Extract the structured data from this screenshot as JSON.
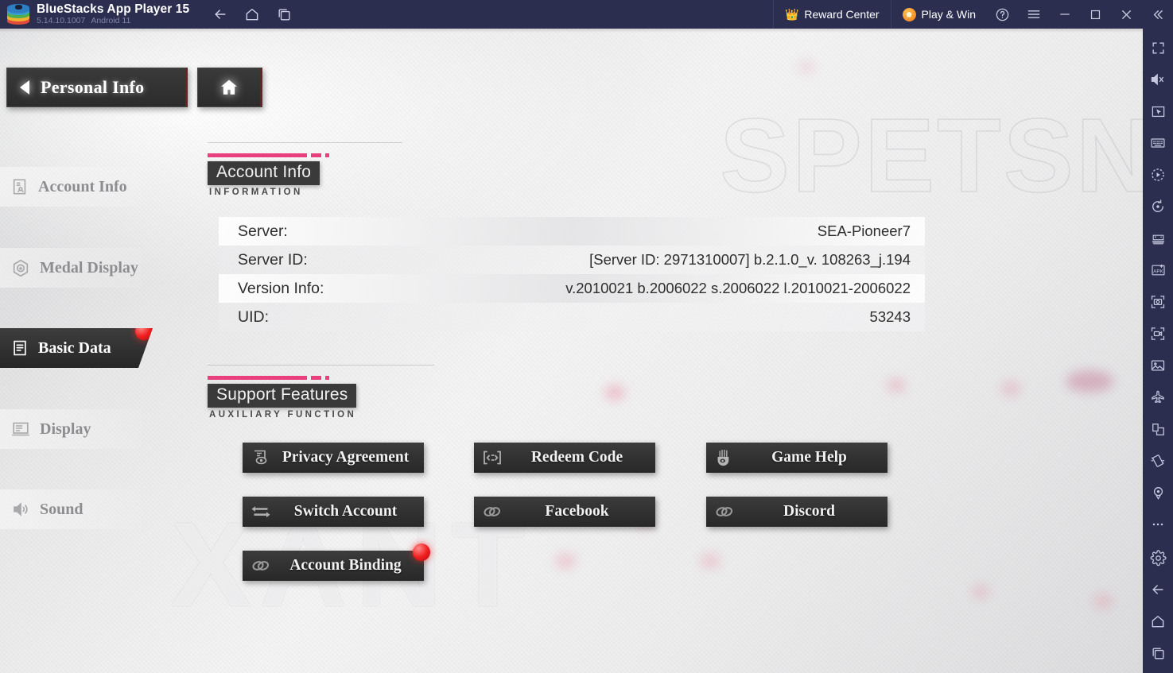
{
  "bluestacks": {
    "title": "BlueStacks App Player 15",
    "version": "5.14.10.1007",
    "android": "Android 11",
    "nav": [
      {
        "name": "back-icon",
        "label": "Back"
      },
      {
        "name": "home-icon",
        "label": "Home"
      },
      {
        "name": "recents-icon",
        "label": "Recent apps"
      }
    ],
    "reward_center": "Reward Center",
    "play_and_win": "Play & Win",
    "window_buttons": [
      {
        "name": "help-icon",
        "label": "Help"
      },
      {
        "name": "menu-icon",
        "label": "Menu"
      },
      {
        "name": "minimize-icon",
        "label": "Minimize"
      },
      {
        "name": "maximize-icon",
        "label": "Maximize"
      },
      {
        "name": "close-icon",
        "label": "Close"
      },
      {
        "name": "collapse-sidebar-icon",
        "label": "Collapse"
      }
    ],
    "accent_bg": "#2b2e4f",
    "sidebar_tools": [
      "fullscreen-icon",
      "mute-icon",
      "cursor-pointer-icon",
      "keyboard-controls-icon",
      "macro-play-icon",
      "sync-rotate-icon",
      "gamepad-icon",
      "apk-install-icon",
      "screenshot-icon",
      "record-video-icon",
      "media-gallery-icon",
      "airplane-icon",
      "multi-instance-icon",
      "shake-icon",
      "location-icon",
      "more-icon",
      "settings-gear-icon",
      "back-arrow-icon",
      "home-icon",
      "recents-icon"
    ]
  },
  "game": {
    "header": {
      "back_label": "Personal Info",
      "home_label": ""
    },
    "watermarks": {
      "big": "SPETSNA",
      "small": "XANT"
    },
    "sidebar": [
      {
        "label": "Account Info",
        "icon": "account-info-icon",
        "active": false,
        "badge": false
      },
      {
        "label": "Medal Display",
        "icon": "medal-icon",
        "active": false,
        "badge": false
      },
      {
        "label": "Basic Data",
        "icon": "document-icon",
        "active": true,
        "badge": true
      },
      {
        "label": "Display",
        "icon": "monitor-icon",
        "active": false,
        "badge": false
      },
      {
        "label": "Sound",
        "icon": "speaker-icon",
        "active": false,
        "badge": false
      }
    ],
    "sections": {
      "account_info": {
        "title": "Account Info",
        "subtitle": "INFORMATION"
      },
      "support": {
        "title": "Support Features",
        "subtitle": "AUXILIARY FUNCTION"
      }
    },
    "info_rows": [
      {
        "key": "Server:",
        "value": "SEA-Pioneer7"
      },
      {
        "key": "Server ID:",
        "value": "[Server ID: 2971310007] b.2.1.0_v. 108263_j.194"
      },
      {
        "key": "Version Info:",
        "value": "v.2010021 b.2006022 s.2006022 l.2010021-2006022"
      },
      {
        "key": "UID:",
        "value": "53243"
      }
    ],
    "support_buttons": [
      {
        "label": "Privacy Agreement",
        "icon": "privacy-eye-icon",
        "badge": false
      },
      {
        "label": "Redeem Code",
        "icon": "redeem-code-icon",
        "badge": false
      },
      {
        "label": "Game Help",
        "icon": "game-help-icon",
        "badge": false
      },
      {
        "label": "Switch Account",
        "icon": "switch-arrows-icon",
        "badge": false
      },
      {
        "label": "Facebook",
        "icon": "link-chain-icon",
        "badge": false
      },
      {
        "label": "Discord",
        "icon": "link-chain-icon",
        "badge": false
      },
      {
        "label": "Account Binding",
        "icon": "link-chain-icon",
        "badge": true
      }
    ],
    "colors": {
      "accent_pink": "#ea3f7e",
      "panel_dark": "#333333",
      "badge_red": "#f01f1f"
    }
  }
}
